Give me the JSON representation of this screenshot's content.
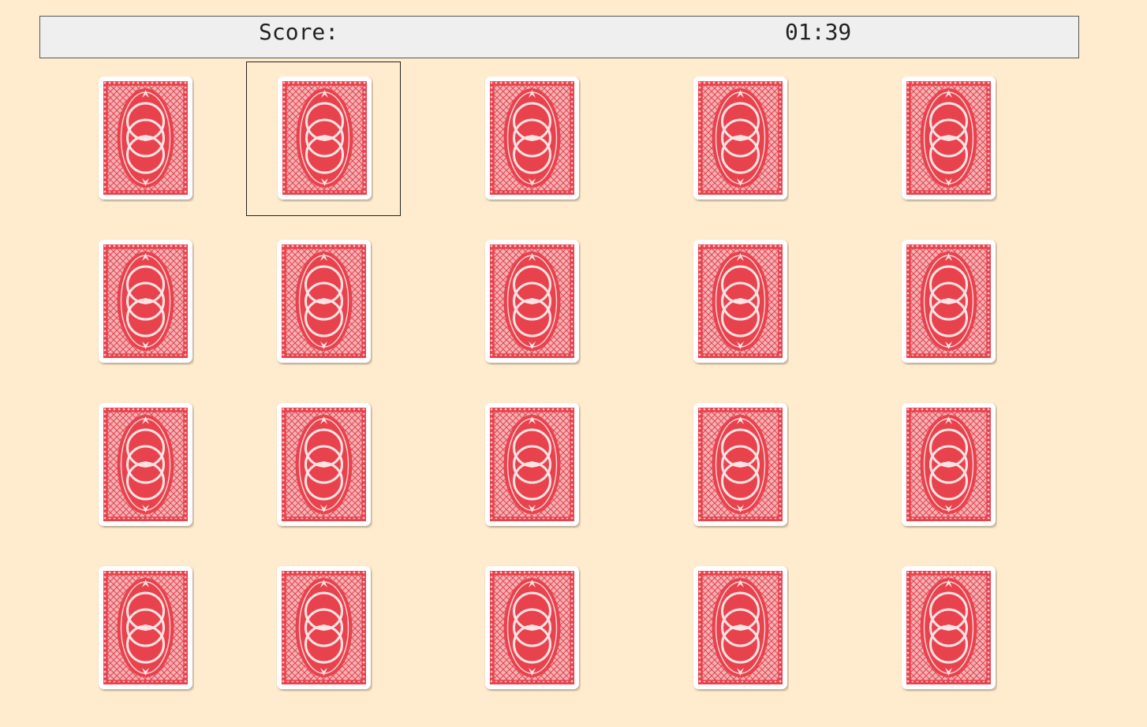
{
  "status": {
    "score_label": "Score:",
    "timer": "01:39"
  },
  "board": {
    "rows": 4,
    "columns": 5,
    "selected_cell": 1,
    "card_back_color": "#e8424d",
    "card_back_light": "#f7a9ad",
    "card_border_color": "#ffffff",
    "card_icon": "playing-card-back-icon"
  },
  "colors": {
    "background": "#ffebcd",
    "status_bar": "#efefef"
  }
}
